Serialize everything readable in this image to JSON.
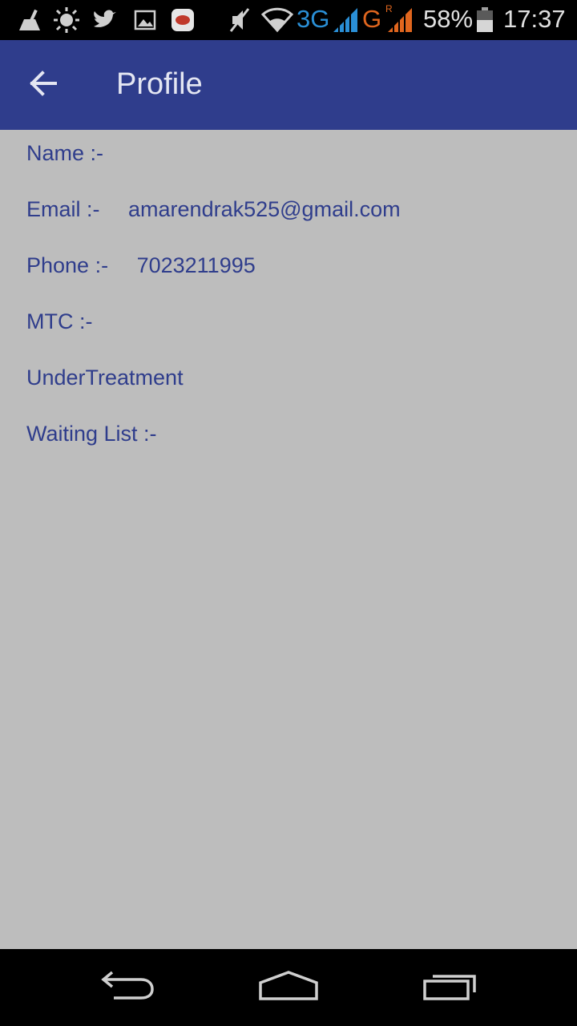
{
  "status_bar": {
    "network_3g": "3G",
    "network_g": "G",
    "roaming": "R",
    "battery": "58%",
    "time": "17:37",
    "icons": [
      "cleaner-icon",
      "brightness-icon",
      "twitter-icon",
      "image-icon",
      "app-badge-icon",
      "mute-icon",
      "wifi-icon",
      "signal-icon",
      "signal-roaming-icon",
      "battery-icon"
    ]
  },
  "app_bar": {
    "title": "Profile",
    "back_icon": "arrow-back-icon"
  },
  "profile": {
    "name_label": "Name :-",
    "name_value": "",
    "email_label": "Email :-",
    "email_value": "amarendrak525@gmail.com",
    "phone_label": "Phone :-",
    "phone_value": "7023211995",
    "mtc_label": "MTC :-",
    "mtc_value": "",
    "under_treatment_label": "UnderTreatment",
    "waiting_list_label": "Waiting List :-",
    "waiting_list_value": ""
  },
  "nav_bar": {
    "icons": [
      "back-nav-icon",
      "home-nav-icon",
      "recents-nav-icon"
    ]
  },
  "colors": {
    "app_bar": "#2f3d8c",
    "background": "#bdbdbd",
    "text_accent": "#2f3d8c",
    "signal_3g": "#2a8fd6",
    "signal_g": "#e0661e"
  }
}
